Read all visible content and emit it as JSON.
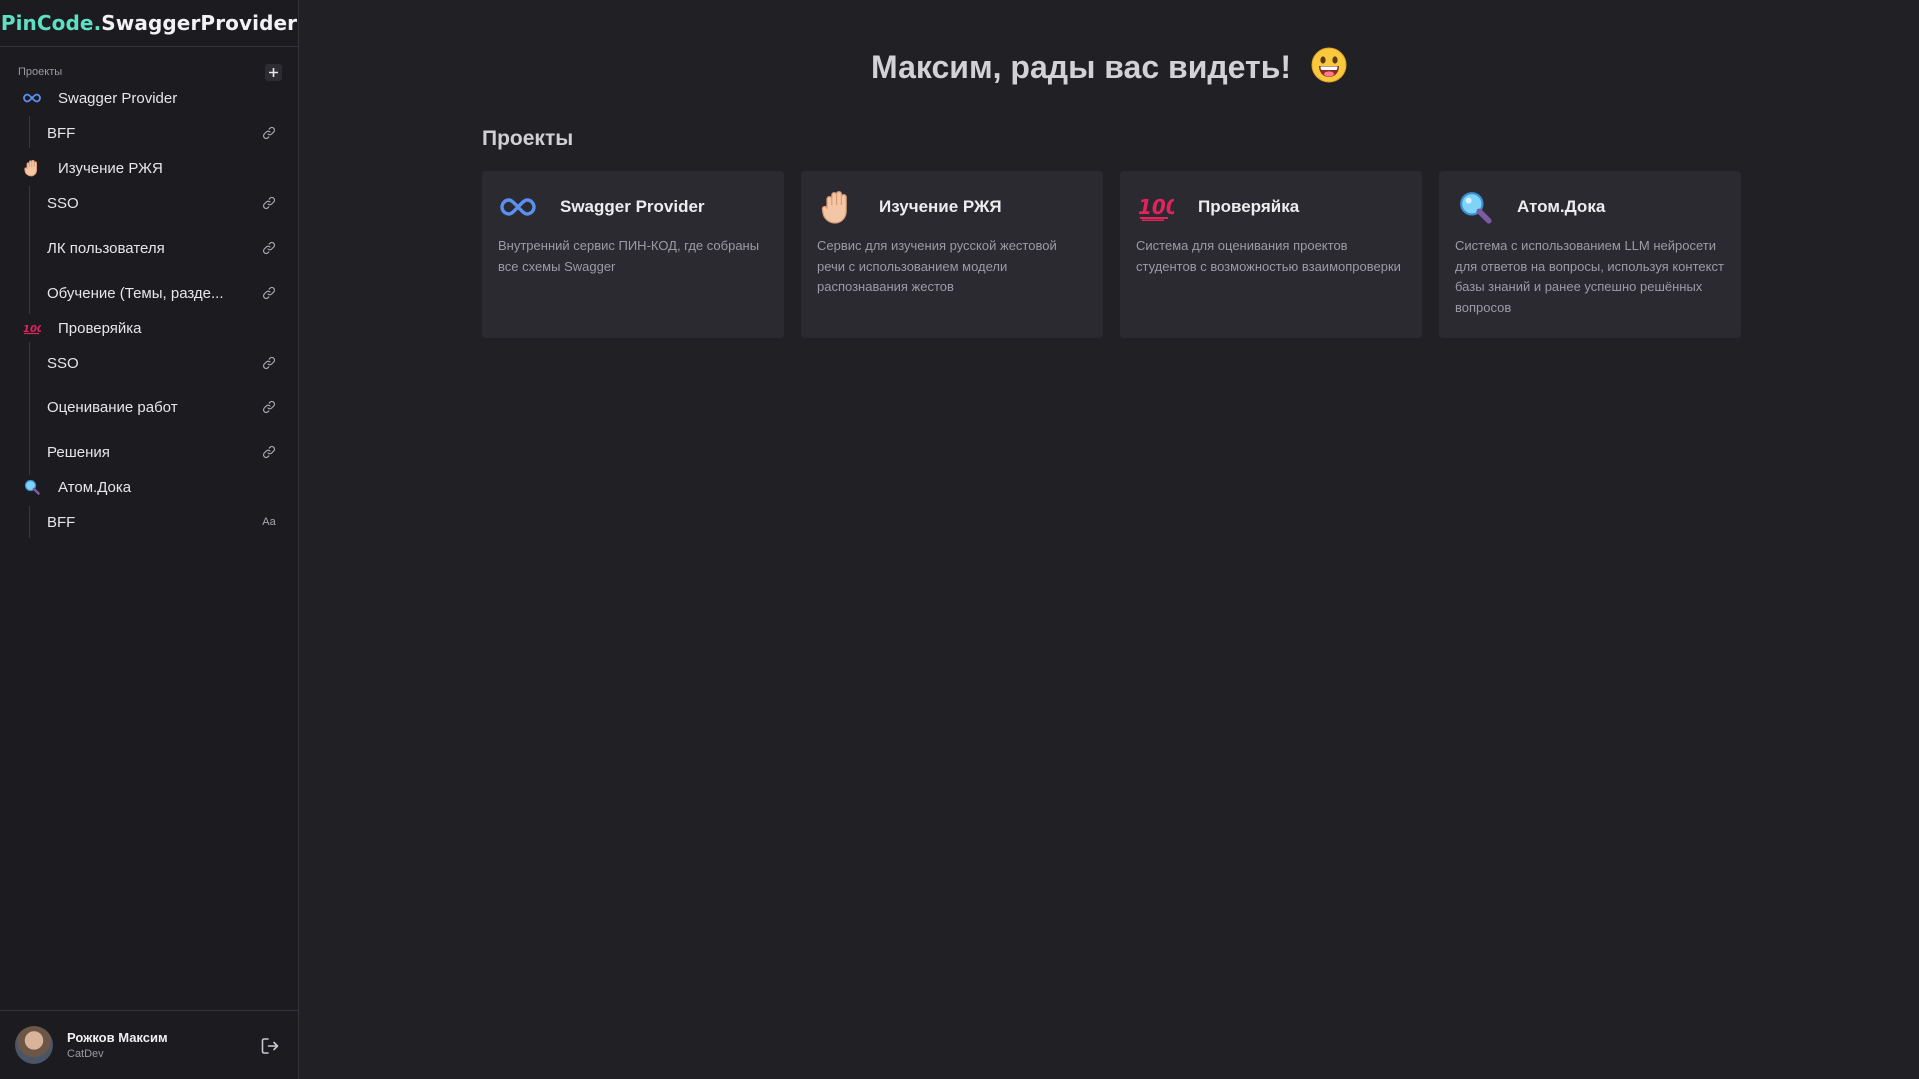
{
  "brand": {
    "part1": "PinCode.",
    "part2": "SwaggerProvider"
  },
  "sidebar": {
    "section_label": "Проекты",
    "projects": [
      {
        "name": "Swagger Provider",
        "icon": "infinity-icon",
        "children": [
          {
            "name": "BFF",
            "action_icon": "link-icon"
          }
        ]
      },
      {
        "name": "Изучение РЖЯ",
        "icon": "raised-hand-icon",
        "children": [
          {
            "name": "SSO",
            "action_icon": "link-icon"
          },
          {
            "name": "ЛК пользователя",
            "action_icon": "link-icon"
          },
          {
            "name": "Обучение (Темы, разде...",
            "action_icon": "link-icon"
          }
        ]
      },
      {
        "name": "Проверяйка",
        "icon": "hundred-points-icon",
        "children": [
          {
            "name": "SSO",
            "action_icon": "link-icon"
          },
          {
            "name": "Оценивание работ",
            "action_icon": "link-icon"
          },
          {
            "name": "Решения",
            "action_icon": "link-icon"
          }
        ]
      },
      {
        "name": "Атом.Дока",
        "icon": "magnifier-icon",
        "children": [
          {
            "name": "BFF",
            "action_icon": "font-aa-icon",
            "action_text": "Aa"
          }
        ]
      }
    ]
  },
  "user": {
    "name": "Рожков Максим",
    "role": "CatDev"
  },
  "main": {
    "greeting": "Максим, рады вас видеть!",
    "section_title": "Проекты",
    "cards": [
      {
        "title": "Swagger Provider",
        "icon": "infinity-icon",
        "description": "Внутренний сервис ПИН-КОД, где собраны все схемы Swagger"
      },
      {
        "title": "Изучение РЖЯ",
        "icon": "raised-hand-icon",
        "description": "Сервис для изучения русской жестовой речи с использованием модели распознавания жестов"
      },
      {
        "title": "Проверяйка",
        "icon": "hundred-points-icon",
        "description": "Система для оценивания проектов студентов с возможностью взаимопроверки"
      },
      {
        "title": "Атом.Дока",
        "icon": "magnifier-icon",
        "description": "Система с использованием LLM нейросети для ответов на вопросы, используя контекст базы знаний и ранее успешно решённых вопросов"
      }
    ]
  },
  "colors": {
    "background": "#212025",
    "sidebar": "#1c1b20",
    "card": "#2b2a30",
    "brand_accent": "#5ee0c4"
  }
}
